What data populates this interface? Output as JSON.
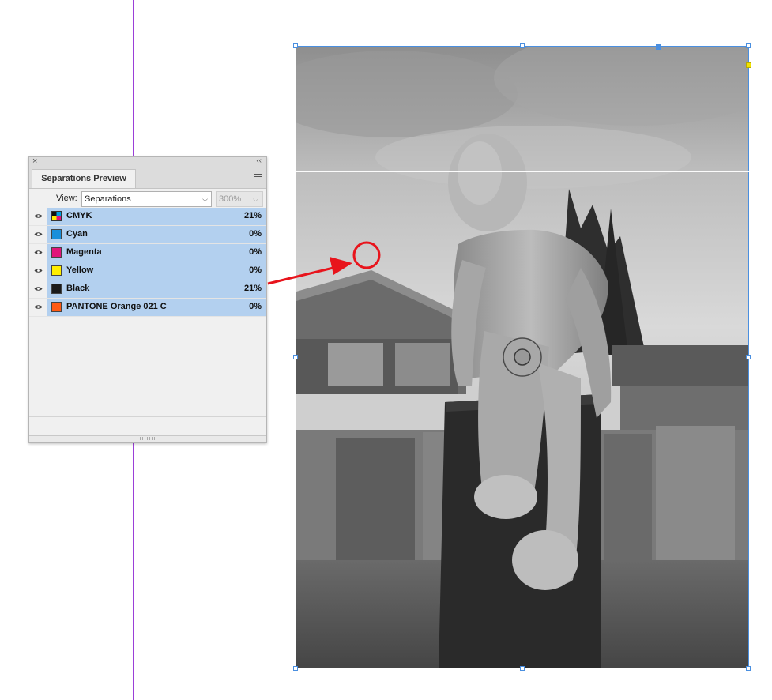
{
  "panel": {
    "close_glyph": "×",
    "collapse_glyph": "‹‹",
    "tab_label": "Separations Preview",
    "view_label": "View:",
    "view_value": "Separations",
    "zoom_value": "300%",
    "separations": [
      {
        "name": "CMYK",
        "percent": "21%",
        "color": "cmyk"
      },
      {
        "name": "Cyan",
        "percent": "0%",
        "color": "#1a8fdb"
      },
      {
        "name": "Magenta",
        "percent": "0%",
        "color": "#e0147a"
      },
      {
        "name": "Yellow",
        "percent": "0%",
        "color": "#ffee00"
      },
      {
        "name": "Black",
        "percent": "21%",
        "color": "#1a1a1a"
      },
      {
        "name": "PANTONE Orange 021 C",
        "percent": "0%",
        "color": "#ff5a14"
      }
    ]
  },
  "colors": {
    "guide": "#9b3fd8",
    "selection": "#4a8fe0",
    "row_highlight": "#b3d0ef",
    "annotation": "#e8141c"
  },
  "icons": [
    "close-icon",
    "collapse-icon",
    "panel-menu-icon",
    "chevron-down-icon",
    "eye-icon",
    "cmyk-swatch-icon"
  ]
}
